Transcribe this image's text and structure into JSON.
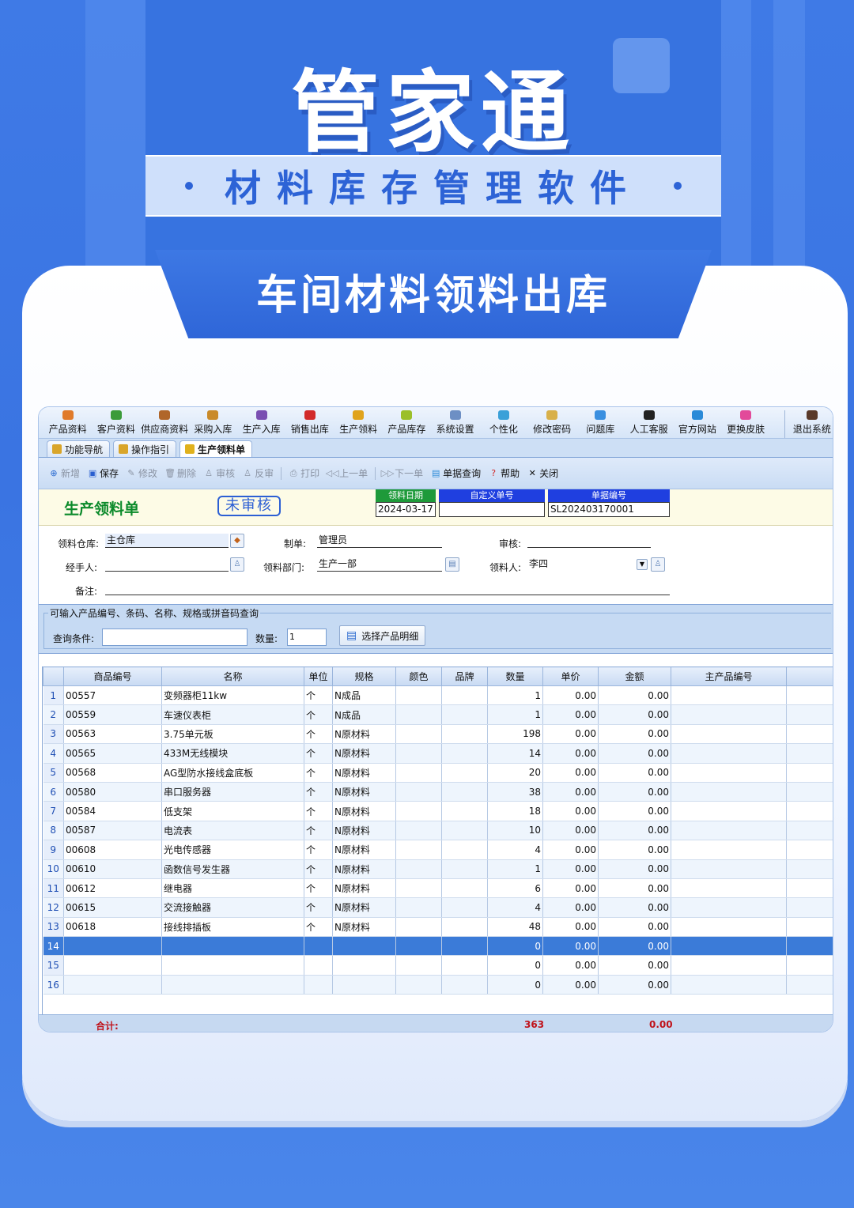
{
  "poster": {
    "brand": "管家通",
    "subtitle": "材料库存管理软件",
    "feature": "车间材料领料出库"
  },
  "menubar": [
    {
      "label": "产品资料",
      "icon": "products-icon",
      "color": "#e07b2c"
    },
    {
      "label": "客户资料",
      "icon": "customers-icon",
      "color": "#3b9b3a"
    },
    {
      "label": "供应商资料",
      "icon": "suppliers-icon",
      "color": "#b0662a"
    },
    {
      "label": "采购入库",
      "icon": "purchase-icon",
      "color": "#c98a2a"
    },
    {
      "label": "生产入库",
      "icon": "production-in-icon",
      "color": "#7a4fb2"
    },
    {
      "label": "销售出库",
      "icon": "sales-out-icon",
      "color": "#d22a2a"
    },
    {
      "label": "生产领料",
      "icon": "material-requisition-icon",
      "color": "#e0a31c"
    },
    {
      "label": "产品库存",
      "icon": "inventory-icon",
      "color": "#9bbf2a"
    },
    {
      "label": "系统设置",
      "icon": "settings-icon",
      "color": "#6d8fc4"
    },
    {
      "label": "个性化",
      "icon": "personalize-icon",
      "color": "#3aa0d8"
    },
    {
      "label": "修改密码",
      "icon": "password-icon",
      "color": "#d8b04a"
    },
    {
      "label": "问题库",
      "icon": "faq-icon",
      "color": "#3a8fe0"
    },
    {
      "label": "人工客服",
      "icon": "support-icon",
      "color": "#222222"
    },
    {
      "label": "官方网站",
      "icon": "website-icon",
      "color": "#2a8ad8"
    },
    {
      "label": "更换皮肤",
      "icon": "skin-icon",
      "color": "#e24a9a"
    }
  ],
  "menu_exit": {
    "label": "退出系统",
    "icon": "exit-icon",
    "color": "#5a3a2a"
  },
  "tabs": [
    {
      "label": "功能导航",
      "active": false
    },
    {
      "label": "操作指引",
      "active": false
    },
    {
      "label": "生产领料单",
      "active": true
    }
  ],
  "toolbar": [
    {
      "label": "新增",
      "icon": "plus-icon",
      "glyph": "⊕",
      "enabled": false
    },
    {
      "label": "保存",
      "icon": "save-icon",
      "glyph": "▣",
      "enabled": true
    },
    {
      "label": "修改",
      "icon": "edit-icon",
      "glyph": "✎",
      "enabled": false
    },
    {
      "label": "删除",
      "icon": "delete-icon",
      "glyph": "🗑",
      "enabled": false
    },
    {
      "label": "审核",
      "icon": "audit-icon",
      "glyph": "♙",
      "enabled": false
    },
    {
      "label": "反审",
      "icon": "unaudit-icon",
      "glyph": "♙",
      "enabled": false
    },
    {
      "label": "打印",
      "icon": "print-icon",
      "glyph": "⎙",
      "enabled": false
    },
    {
      "label": "上一单",
      "icon": "prev-icon",
      "glyph": "◁◁",
      "enabled": false
    },
    {
      "label": "下一单",
      "icon": "next-icon",
      "glyph": "▷▷",
      "enabled": false
    },
    {
      "label": "单据查询",
      "icon": "query-icon",
      "glyph": "▤",
      "enabled": true
    },
    {
      "label": "帮助",
      "icon": "help-icon",
      "glyph": "?",
      "enabled": true
    },
    {
      "label": "关闭",
      "icon": "close-icon",
      "glyph": "✕",
      "enabled": true
    }
  ],
  "form": {
    "title": "生产领料单",
    "status": "未审核",
    "date_label": "领料日期",
    "date_value": "2024-03-17",
    "custom_no_label": "自定义单号",
    "custom_no_value": "",
    "doc_no_label": "单据编号",
    "doc_no_value": "SL202403170001",
    "warehouse_label": "领料仓库:",
    "warehouse_value": "主仓库",
    "maker_label": "制单:",
    "maker_value": "管理员",
    "auditor_label": "审核:",
    "auditor_value": "",
    "handler_label": "经手人:",
    "handler_value": "",
    "dept_label": "领料部门:",
    "dept_value": "生产一部",
    "receiver_label": "领料人:",
    "receiver_value": "李四",
    "remark_label": "备注:",
    "remark_value": ""
  },
  "query": {
    "legend": "可输入产品编号、条码、名称、规格或拼音码查询",
    "condition_label": "查询条件:",
    "condition_value": "",
    "qty_label": "数量:",
    "qty_value": "1",
    "select_button": "选择产品明细"
  },
  "grid": {
    "columns": [
      "",
      "商品编号",
      "名称",
      "单位",
      "规格",
      "颜色",
      "品牌",
      "数量",
      "单价",
      "金额",
      "主产品编号",
      ""
    ],
    "rows": [
      [
        "1",
        "00557",
        "变频器柜11kw",
        "个",
        "N成品",
        "",
        "",
        "1",
        "0.00",
        "0.00",
        "",
        ""
      ],
      [
        "2",
        "00559",
        "车速仪表柜",
        "个",
        "N成品",
        "",
        "",
        "1",
        "0.00",
        "0.00",
        "",
        ""
      ],
      [
        "3",
        "00563",
        "3.75单元板",
        "个",
        "N原材料",
        "",
        "",
        "198",
        "0.00",
        "0.00",
        "",
        ""
      ],
      [
        "4",
        "00565",
        "433M无线模块",
        "个",
        "N原材料",
        "",
        "",
        "14",
        "0.00",
        "0.00",
        "",
        ""
      ],
      [
        "5",
        "00568",
        "AG型防水接线盒底板",
        "个",
        "N原材料",
        "",
        "",
        "20",
        "0.00",
        "0.00",
        "",
        ""
      ],
      [
        "6",
        "00580",
        "串口服务器",
        "个",
        "N原材料",
        "",
        "",
        "38",
        "0.00",
        "0.00",
        "",
        ""
      ],
      [
        "7",
        "00584",
        "低支架",
        "个",
        "N原材料",
        "",
        "",
        "18",
        "0.00",
        "0.00",
        "",
        ""
      ],
      [
        "8",
        "00587",
        "电流表",
        "个",
        "N原材料",
        "",
        "",
        "10",
        "0.00",
        "0.00",
        "",
        ""
      ],
      [
        "9",
        "00608",
        "光电传感器",
        "个",
        "N原材料",
        "",
        "",
        "4",
        "0.00",
        "0.00",
        "",
        ""
      ],
      [
        "10",
        "00610",
        "函数信号发生器",
        "个",
        "N原材料",
        "",
        "",
        "1",
        "0.00",
        "0.00",
        "",
        ""
      ],
      [
        "11",
        "00612",
        "继电器",
        "个",
        "N原材料",
        "",
        "",
        "6",
        "0.00",
        "0.00",
        "",
        ""
      ],
      [
        "12",
        "00615",
        "交流接触器",
        "个",
        "N原材料",
        "",
        "",
        "4",
        "0.00",
        "0.00",
        "",
        ""
      ],
      [
        "13",
        "00618",
        "接线排插板",
        "个",
        "N原材料",
        "",
        "",
        "48",
        "0.00",
        "0.00",
        "",
        ""
      ],
      [
        "14",
        "",
        "",
        "",
        "",
        "",
        "",
        "0",
        "0.00",
        "0.00",
        "",
        ""
      ],
      [
        "15",
        "",
        "",
        "",
        "",
        "",
        "",
        "0",
        "0.00",
        "0.00",
        "",
        ""
      ],
      [
        "16",
        "",
        "",
        "",
        "",
        "",
        "",
        "0",
        "0.00",
        "0.00",
        "",
        ""
      ]
    ],
    "selected_row": "14"
  },
  "footer": {
    "total_label": "合计:",
    "total_qty": "363",
    "total_amount": "0.00"
  }
}
